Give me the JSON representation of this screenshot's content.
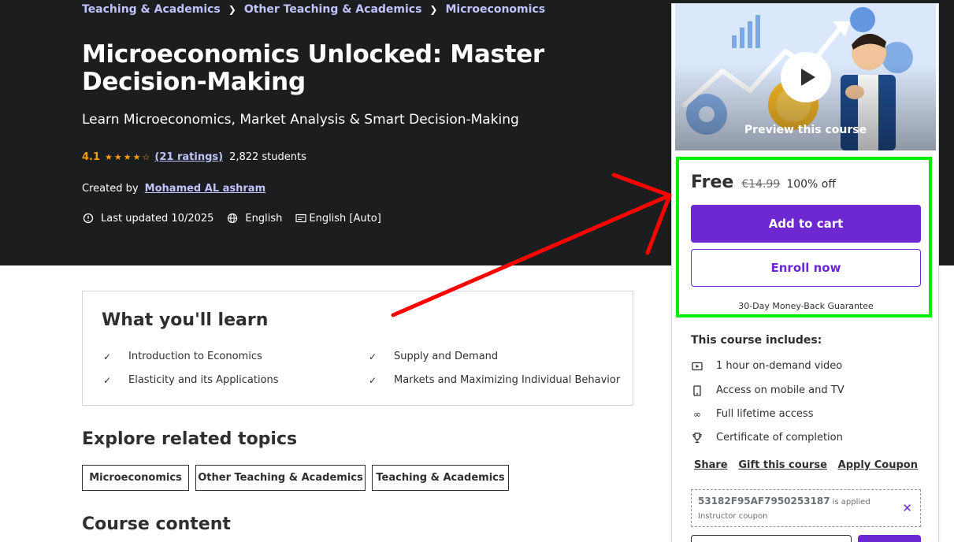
{
  "breadcrumb": [
    "Teaching & Academics",
    "Other Teaching & Academics",
    "Microeconomics"
  ],
  "course": {
    "title": "Microeconomics Unlocked: Master Decision-Making",
    "subtitle": "Learn Microeconomics, Market Analysis & Smart Decision-Making",
    "rating": "4.1",
    "stars": 4.1,
    "ratings_link": "(21 ratings)",
    "students": "2,822 students",
    "created_by_label": "Created by",
    "author": "Mohamed AL ashram",
    "last_updated": "Last updated 10/2025",
    "language": "English",
    "captions": "English [Auto]"
  },
  "learn": {
    "title": "What you'll learn",
    "items": [
      "Introduction to Economics",
      "Supply and Demand",
      "Elasticity and its Applications",
      "Markets and Maximizing Individual Behavior"
    ]
  },
  "related": {
    "title": "Explore related topics",
    "topics": [
      "Microeconomics",
      "Other Teaching & Academics",
      "Teaching & Academics"
    ]
  },
  "course_content_title": "Course content",
  "sidebar": {
    "preview_label": "Preview this course",
    "price_now": "Free",
    "price_original": "€14.99",
    "discount": "100% off",
    "add_to_cart": "Add to cart",
    "enroll_now": "Enroll now",
    "guarantee": "30-Day Money-Back Guarantee",
    "includes_title": "This course includes:",
    "includes": [
      {
        "icon": "video-icon",
        "label": "1 hour on-demand video"
      },
      {
        "icon": "mobile-icon",
        "label": "Access on mobile and TV"
      },
      {
        "icon": "infinity-icon",
        "label": "Full lifetime access"
      },
      {
        "icon": "trophy-icon",
        "label": "Certificate of completion"
      }
    ],
    "links": [
      "Share",
      "Gift this course",
      "Apply Coupon"
    ],
    "coupon": {
      "code": "53182F95AF7950253187",
      "applied": "is applied",
      "type": "Instructor coupon"
    }
  },
  "colors": {
    "hero_bg": "#1c1d1f",
    "accent_purple": "#6d28d2",
    "link_lavender": "#c0c4fc",
    "star_orange": "#f69c08",
    "highlight_green": "#00ee00",
    "arrow_red": "#ff0000"
  }
}
